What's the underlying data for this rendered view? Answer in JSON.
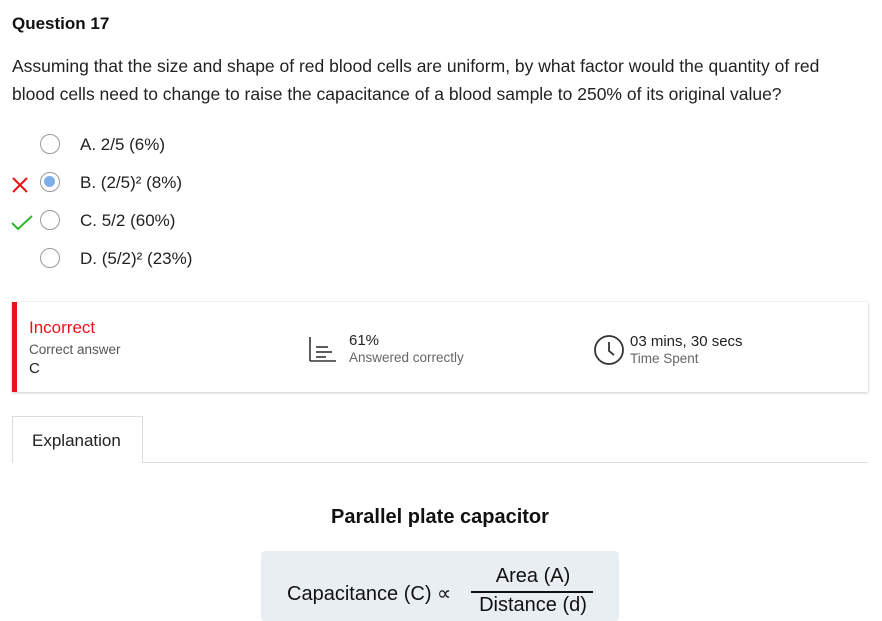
{
  "question": {
    "title": "Question 17",
    "text": "Assuming that the size and shape of red blood cells are uniform, by what factor would the quantity of red blood cells need to change to raise the capacitance of a blood sample to 250% of its original value?"
  },
  "options": [
    {
      "label": "A.  2/5  (6%)",
      "state": "none"
    },
    {
      "label": "B.  (2/5)²  (8%)",
      "state": "selected-wrong"
    },
    {
      "label": "C.  5/2  (60%)",
      "state": "correct"
    },
    {
      "label": "D.  (5/2)²  (23%)",
      "state": "none"
    }
  ],
  "result": {
    "status": "Incorrect",
    "correct_answer_label": "Correct answer",
    "correct_answer": "C",
    "percent_value": "61%",
    "percent_label": "Answered correctly",
    "time_value": "03 mins, 30 secs",
    "time_label": "Time Spent"
  },
  "tabs": {
    "explanation": "Explanation"
  },
  "explanation": {
    "title": "Parallel plate capacitor",
    "formula_lhs": "Capacitance (C) ∝",
    "formula_num": "Area (A)",
    "formula_den": "Distance (d)"
  },
  "colors": {
    "incorrect": "#e8141a",
    "correct": "#2eb82e",
    "selected_fill": "#80aee8"
  },
  "icons": {
    "wrong": "x-mark-icon",
    "right": "check-mark-icon",
    "stats": "bar-stats-icon",
    "time": "clock-icon"
  }
}
